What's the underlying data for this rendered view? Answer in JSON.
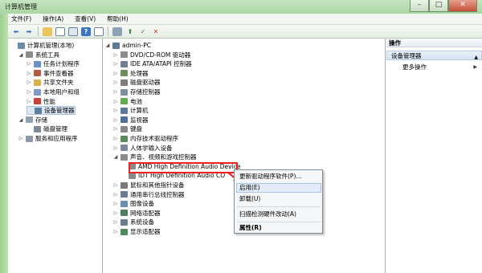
{
  "window": {
    "title": "计算机管理"
  },
  "menu": [
    "文件(F)",
    "操作(A)",
    "查看(V)",
    "帮助(H)"
  ],
  "toolbar_icons": [
    "back-icon",
    "forward-icon",
    "up-folder-icon",
    "show-hide-tree-icon",
    "properties-icon",
    "help-icon",
    "console-icon",
    "update-driver-icon",
    "disable-device-icon",
    "uninstall-icon",
    "scan-changes-icon"
  ],
  "left_tree": [
    {
      "label": "计算机管理(本地)",
      "level": 0,
      "expander": "",
      "icon": "computer-management-icon",
      "color": "#6f8aa6"
    },
    {
      "label": "系统工具",
      "level": 1,
      "expander": "◢",
      "icon": "tools-icon",
      "color": "#8d8d8d"
    },
    {
      "label": "任务计划程序",
      "level": 2,
      "expander": "▷",
      "icon": "clock-icon",
      "color": "#6b8fc7"
    },
    {
      "label": "事件查看器",
      "level": 2,
      "expander": "▷",
      "icon": "event-viewer-icon",
      "color": "#b55a44"
    },
    {
      "label": "共享文件夹",
      "level": 2,
      "expander": "▷",
      "icon": "shared-folder-icon",
      "color": "#d9b24c"
    },
    {
      "label": "本地用户和组",
      "level": 2,
      "expander": "▷",
      "icon": "users-icon",
      "color": "#7d9bc4"
    },
    {
      "label": "性能",
      "level": 2,
      "expander": "▷",
      "icon": "performance-icon",
      "color": "#c9413b"
    },
    {
      "label": "设备管理器",
      "level": 2,
      "expander": "",
      "icon": "device-manager-icon",
      "color": "#5d7f9d",
      "selected": true
    },
    {
      "label": "存储",
      "level": 1,
      "expander": "◢",
      "icon": "storage-icon",
      "color": "#8da1b3"
    },
    {
      "label": "磁盘管理",
      "level": 2,
      "expander": "",
      "icon": "disk-icon",
      "color": "#7b8a99"
    },
    {
      "label": "服务和应用程序",
      "level": 1,
      "expander": "▷",
      "icon": "services-icon",
      "color": "#8b9bab"
    }
  ],
  "device_tree": [
    {
      "label": "admin-PC",
      "level": 0,
      "expander": "◢",
      "icon": "computer-icon",
      "color": "#5b7a99"
    },
    {
      "label": "DVD/CD-ROM 驱动器",
      "level": 1,
      "expander": "▷",
      "icon": "dvd-icon",
      "color": "#8c8c8c"
    },
    {
      "label": "IDE ATA/ATAPI 控制器",
      "level": 1,
      "expander": "▷",
      "icon": "ide-icon",
      "color": "#6f7f8f"
    },
    {
      "label": "处理器",
      "level": 1,
      "expander": "▷",
      "icon": "processor-icon",
      "color": "#6b8e5b"
    },
    {
      "label": "磁盘驱动器",
      "level": 1,
      "expander": "▷",
      "icon": "disk-drive-icon",
      "color": "#7d7d7d"
    },
    {
      "label": "存储控制器",
      "level": 1,
      "expander": "▷",
      "icon": "storage-controller-icon",
      "color": "#7b8fa3"
    },
    {
      "label": "电池",
      "level": 1,
      "expander": "▷",
      "icon": "battery-icon",
      "color": "#5fae4f"
    },
    {
      "label": "计算机",
      "level": 1,
      "expander": "▷",
      "icon": "computer-small-icon",
      "color": "#5b7a99"
    },
    {
      "label": "监视器",
      "level": 1,
      "expander": "▷",
      "icon": "monitor-icon",
      "color": "#4f6f9a"
    },
    {
      "label": "键盘",
      "level": 1,
      "expander": "▷",
      "icon": "keyboard-icon",
      "color": "#888888"
    },
    {
      "label": "内存技术驱动程序",
      "level": 1,
      "expander": "▷",
      "icon": "memory-icon",
      "color": "#5a8a5a"
    },
    {
      "label": "人体学输入设备",
      "level": 1,
      "expander": "▷",
      "icon": "hid-icon",
      "color": "#7a8a9a"
    },
    {
      "label": "声音、视频和游戏控制器",
      "level": 1,
      "expander": "◢",
      "icon": "sound-icon",
      "color": "#8a8a8a"
    },
    {
      "label": "AMD High Definition Audio Device",
      "level": 2,
      "expander": "",
      "icon": "audio-device-icon",
      "color": "#8a8a8a",
      "highlighted": true
    },
    {
      "label": "IDT High Definition Audio CO",
      "level": 2,
      "expander": "",
      "icon": "audio-device-icon",
      "color": "#8a8a8a"
    },
    {
      "label": "鼠标和其他指针设备",
      "level": 1,
      "expander": "▷",
      "icon": "mouse-icon",
      "color": "#7a7a7a"
    },
    {
      "label": "通用串行总线控制器",
      "level": 1,
      "expander": "▷",
      "icon": "usb-icon",
      "color": "#6a7d90"
    },
    {
      "label": "图像设备",
      "level": 1,
      "expander": "▷",
      "icon": "camera-icon",
      "color": "#6b8fb0"
    },
    {
      "label": "网络适配器",
      "level": 1,
      "expander": "▷",
      "icon": "network-icon",
      "color": "#4f7f5f"
    },
    {
      "label": "系统设备",
      "level": 1,
      "expander": "▷",
      "icon": "system-device-icon",
      "color": "#6b7f93"
    },
    {
      "label": "显示适配器",
      "level": 1,
      "expander": "▷",
      "icon": "display-adapter-icon",
      "color": "#4f8a5f"
    }
  ],
  "context_menu": {
    "items": [
      {
        "label": "更新驱动程序软件(P)...",
        "bold": false
      },
      {
        "label": "启用(E)",
        "bold": false,
        "hover": true
      },
      {
        "label": "卸载(U)",
        "bold": false
      },
      {
        "label": "扫描检测硬件改动(A)",
        "bold": false
      },
      {
        "label": "属性(R)",
        "bold": true
      }
    ]
  },
  "actions": {
    "header": "操作",
    "section": "设备管理器",
    "more": "更多操作"
  }
}
